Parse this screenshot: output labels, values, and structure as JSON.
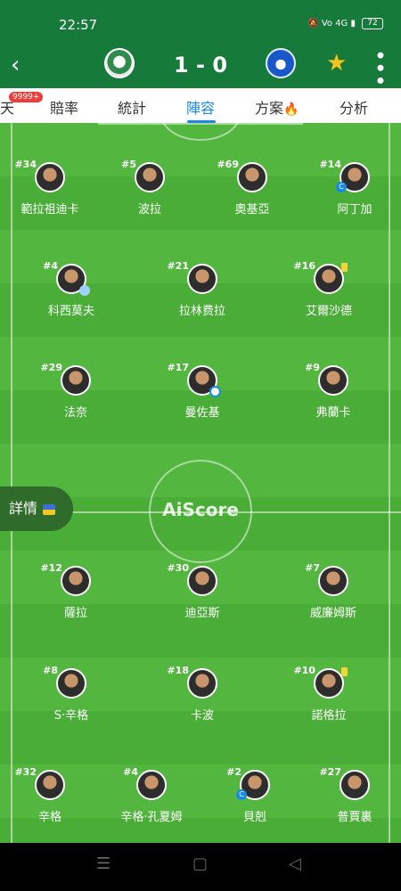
{
  "status": {
    "time": "22:57",
    "icons": "🔕 Vo 4G ▮",
    "battery": "72"
  },
  "header": {
    "back_icon": "‹",
    "score": "1 - 0",
    "star_icon": "★",
    "more_icon": "•••"
  },
  "tabs": {
    "partial": "天",
    "badge": "9999+",
    "odds": "賠率",
    "stats": "統計",
    "lineup": "陣容",
    "plan": "方案",
    "flame_icon": "🔥",
    "analysis": "分析"
  },
  "pitch": {
    "brand": "AiScore"
  },
  "details": {
    "label": "詳情"
  },
  "away": [
    {
      "num": "#34",
      "name": "範拉祖迪卡"
    },
    {
      "num": "#5",
      "name": "波拉"
    },
    {
      "num": "#69",
      "name": "奧基亞"
    },
    {
      "num": "#14",
      "name": "阿丁加",
      "cap": "C"
    },
    {
      "num": "#4",
      "name": "科西莫夫"
    },
    {
      "num": "#21",
      "name": "拉林费拉"
    },
    {
      "num": "#16",
      "name": "艾爾沙德"
    },
    {
      "num": "#29",
      "name": "法奈"
    },
    {
      "num": "#17",
      "name": "曼佐基"
    },
    {
      "num": "#9",
      "name": "弗蘭卡"
    }
  ],
  "home": [
    {
      "num": "#12",
      "name": "薩拉"
    },
    {
      "num": "#30",
      "name": "迪亞斯"
    },
    {
      "num": "#7",
      "name": "威廉姆斯"
    },
    {
      "num": "#8",
      "name": "S·辛格"
    },
    {
      "num": "#18",
      "name": "卡波"
    },
    {
      "num": "#10",
      "name": "諾格拉"
    },
    {
      "num": "#32",
      "name": "辛格"
    },
    {
      "num": "#4",
      "name": "辛格·孔夏姆"
    },
    {
      "num": "#2",
      "name": "貝剋",
      "cap": "C"
    },
    {
      "num": "#27",
      "name": "普賈裏"
    }
  ],
  "navbar": {
    "menu": "☰",
    "home": "▢",
    "back": "◁"
  }
}
